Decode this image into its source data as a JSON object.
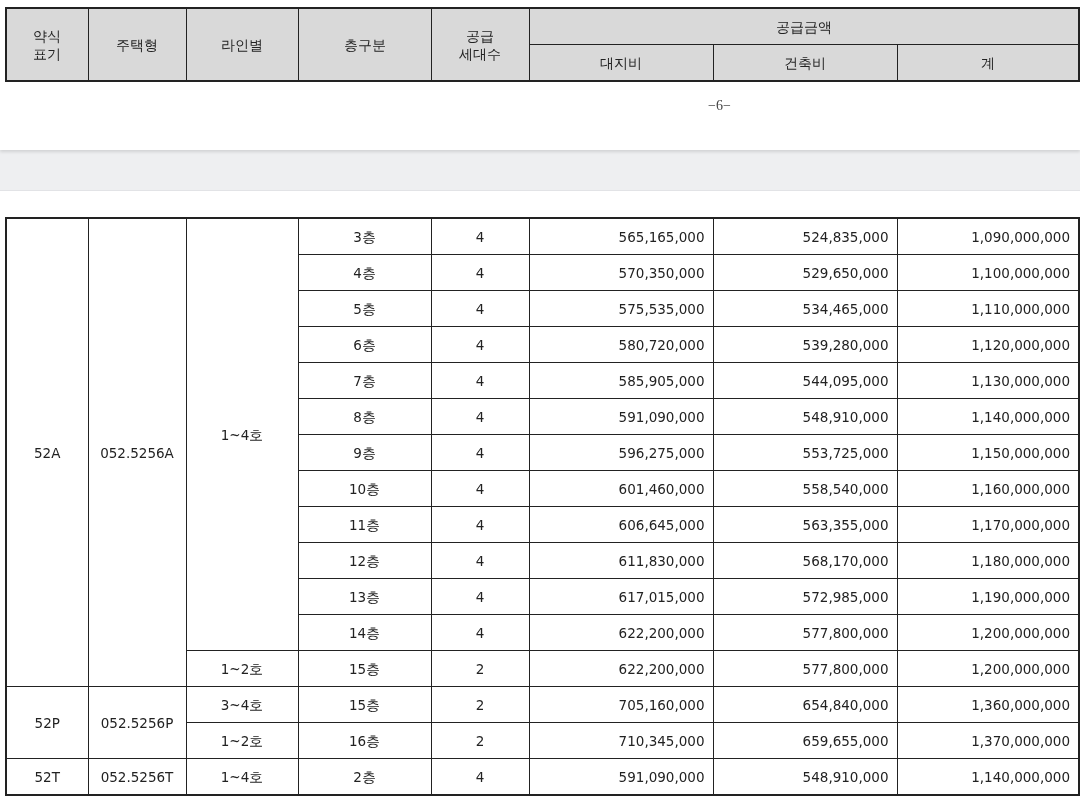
{
  "page_top": {
    "header": {
      "abbr": "약식\n표기",
      "type": "주택형",
      "line": "라인별",
      "floor": "층구분",
      "units": "공급\n세대수",
      "amount": "공급금액",
      "land": "대지비",
      "building": "건축비",
      "total": "계"
    },
    "page_number": "−6−"
  },
  "page_bottom": {
    "groups": [
      {
        "abbr": "52A",
        "type": "052.5256A",
        "lines": [
          {
            "line": "1~4호",
            "floors": [
              {
                "floor": "3층",
                "units": "4",
                "land": "565,165,000",
                "building": "524,835,000",
                "total": "1,090,000,000"
              },
              {
                "floor": "4층",
                "units": "4",
                "land": "570,350,000",
                "building": "529,650,000",
                "total": "1,100,000,000"
              },
              {
                "floor": "5층",
                "units": "4",
                "land": "575,535,000",
                "building": "534,465,000",
                "total": "1,110,000,000"
              },
              {
                "floor": "6층",
                "units": "4",
                "land": "580,720,000",
                "building": "539,280,000",
                "total": "1,120,000,000"
              },
              {
                "floor": "7층",
                "units": "4",
                "land": "585,905,000",
                "building": "544,095,000",
                "total": "1,130,000,000"
              },
              {
                "floor": "8층",
                "units": "4",
                "land": "591,090,000",
                "building": "548,910,000",
                "total": "1,140,000,000"
              },
              {
                "floor": "9층",
                "units": "4",
                "land": "596,275,000",
                "building": "553,725,000",
                "total": "1,150,000,000"
              },
              {
                "floor": "10층",
                "units": "4",
                "land": "601,460,000",
                "building": "558,540,000",
                "total": "1,160,000,000"
              },
              {
                "floor": "11층",
                "units": "4",
                "land": "606,645,000",
                "building": "563,355,000",
                "total": "1,170,000,000"
              },
              {
                "floor": "12층",
                "units": "4",
                "land": "611,830,000",
                "building": "568,170,000",
                "total": "1,180,000,000"
              },
              {
                "floor": "13층",
                "units": "4",
                "land": "617,015,000",
                "building": "572,985,000",
                "total": "1,190,000,000"
              },
              {
                "floor": "14층",
                "units": "4",
                "land": "622,200,000",
                "building": "577,800,000",
                "total": "1,200,000,000"
              }
            ]
          },
          {
            "line": "1~2호",
            "floors": [
              {
                "floor": "15층",
                "units": "2",
                "land": "622,200,000",
                "building": "577,800,000",
                "total": "1,200,000,000"
              }
            ]
          }
        ]
      },
      {
        "abbr": "52P",
        "type": "052.5256P",
        "lines": [
          {
            "line": "3~4호",
            "floors": [
              {
                "floor": "15층",
                "units": "2",
                "land": "705,160,000",
                "building": "654,840,000",
                "total": "1,360,000,000"
              }
            ]
          },
          {
            "line": "1~2호",
            "floors": [
              {
                "floor": "16층",
                "units": "2",
                "land": "710,345,000",
                "building": "659,655,000",
                "total": "1,370,000,000"
              }
            ]
          }
        ]
      },
      {
        "abbr": "52T",
        "type": "052.5256T",
        "lines": [
          {
            "line": "1~4호",
            "floors": [
              {
                "floor": "2층",
                "units": "4",
                "land": "591,090,000",
                "building": "548,910,000",
                "total": "1,140,000,000"
              }
            ]
          }
        ]
      }
    ]
  }
}
